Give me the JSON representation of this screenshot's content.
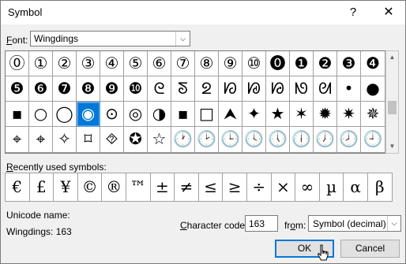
{
  "window": {
    "title": "Symbol",
    "help_label": "?",
    "close_label": "✕"
  },
  "font": {
    "label_ul": "F",
    "label_rest": "ont:",
    "value": "Wingdings",
    "arrow": "⌵"
  },
  "symbols": [
    [
      "⓪",
      "①",
      "②",
      "③",
      "④",
      "⑤",
      "⑥",
      "⑦",
      "⑧",
      "⑨",
      "⑩",
      "⓿",
      "❶",
      "❷",
      "❸",
      "❹"
    ],
    [
      "❺",
      "❻",
      "❼",
      "❽",
      "❾",
      "❿",
      "ᘓ",
      "ᘕ",
      "ᘖ",
      "ᘗ",
      "ᘘ",
      "ᘙ",
      "ᘚ",
      "ᘛ",
      "•",
      "●"
    ],
    [
      "▪",
      "○",
      "◯",
      "◉",
      "⊙",
      "◎",
      "◑",
      "▪",
      "□",
      "⮝",
      "✦",
      "★",
      "✶",
      "✹",
      "✷",
      "✵"
    ],
    [
      "⌖",
      "⌖",
      "✧",
      "⌑",
      "⯑",
      "✪",
      "☆",
      "🕐",
      "🕑",
      "🕒",
      "🕓",
      "🕔",
      "🕕",
      "🕖",
      "🕗",
      "🕘"
    ]
  ],
  "selected": {
    "row": 2,
    "col": 3
  },
  "recent": {
    "label": "Recently used symbols:",
    "label_ul": "R",
    "label_rest": "ecently used symbols:",
    "items": [
      "€",
      "£",
      "¥",
      "©",
      "®",
      "™",
      "±",
      "≠",
      "≤",
      "≥",
      "÷",
      "×",
      "∞",
      "µ",
      "α",
      "β"
    ]
  },
  "unicode": {
    "label": "Unicode name:",
    "value": "Wingdings: 163"
  },
  "character_code": {
    "label_pre": "",
    "label_ul": "C",
    "label_rest": "haracter code:",
    "value": "163"
  },
  "from": {
    "label_pre": "fr",
    "label_ul": "o",
    "label_rest": "m:",
    "value": "Symbol (decimal)",
    "arrow": "⌵"
  },
  "scrollbar": {
    "up": "▲",
    "down": "▼"
  },
  "buttons": {
    "ok": "OK",
    "cancel": "Cancel"
  }
}
